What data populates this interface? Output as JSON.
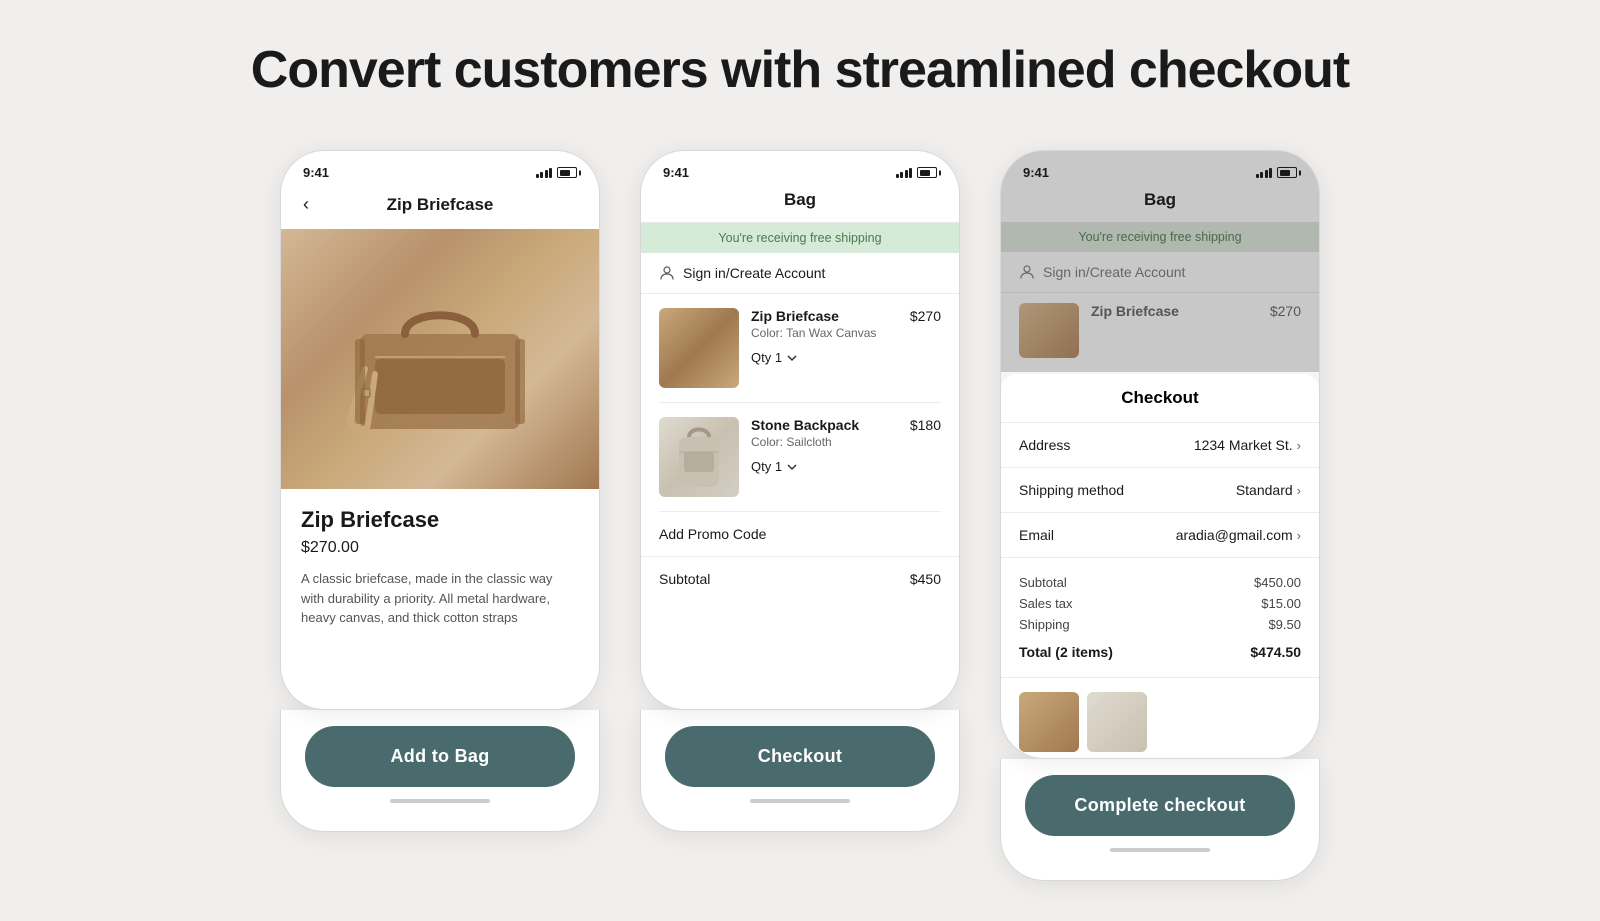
{
  "page": {
    "title": "Convert customers with streamlined checkout"
  },
  "phone1": {
    "status_time": "9:41",
    "header_title": "Zip Briefcase",
    "product_name": "Zip Briefcase",
    "product_price": "$270.00",
    "product_description": "A classic briefcase, made in the classic way with durability a priority. All metal hardware, heavy canvas, and thick cotton straps",
    "button_label": "Add to Bag"
  },
  "phone2": {
    "status_time": "9:41",
    "header_title": "Bag",
    "free_shipping_text": "You're receiving free shipping",
    "sign_in_text": "Sign in/Create Account",
    "items": [
      {
        "name": "Zip Briefcase",
        "color": "Color: Tan Wax Canvas",
        "price": "$270",
        "qty": "Qty 1"
      },
      {
        "name": "Stone Backpack",
        "color": "Color: Sailcloth",
        "price": "$180",
        "qty": "Qty 1"
      }
    ],
    "promo_label": "Add Promo Code",
    "subtotal_label": "Subtotal",
    "subtotal_value": "$450",
    "button_label": "Checkout"
  },
  "phone3": {
    "status_time": "9:41",
    "header_title": "Bag",
    "free_shipping_text": "You're receiving free shipping",
    "sign_in_text": "Sign in/Create Account",
    "item_name": "Zip Briefcase",
    "item_price": "$270",
    "checkout_title": "Checkout",
    "address_label": "Address",
    "address_value": "1234 Market St.",
    "shipping_label": "Shipping method",
    "shipping_value": "Standard",
    "email_label": "Email",
    "email_value": "aradia@gmail.com",
    "subtotal_label": "Subtotal",
    "subtotal_value": "$450.00",
    "tax_label": "Sales tax",
    "tax_value": "$15.00",
    "shipping_cost_label": "Shipping",
    "shipping_cost_value": "$9.50",
    "total_label": "Total (2 items)",
    "total_value": "$474.50",
    "button_label": "Complete checkout"
  }
}
